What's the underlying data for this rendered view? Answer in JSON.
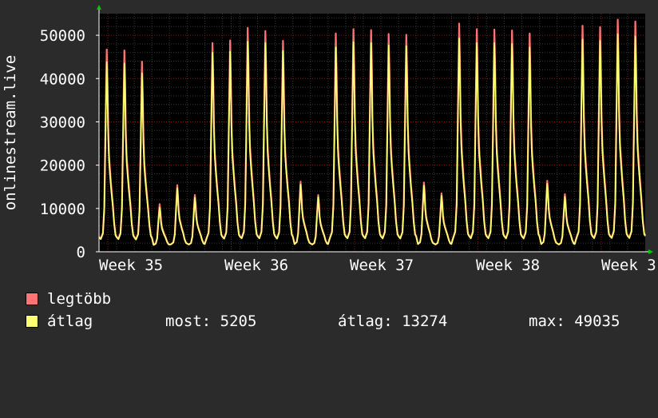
{
  "chart_data": {
    "type": "line",
    "ylabel": "onlinestream.live",
    "yticks": [
      0,
      10000,
      20000,
      30000,
      40000,
      50000
    ],
    "ylim": [
      0,
      55000
    ],
    "xticks": [
      "Week 35",
      "Week 36",
      "Week 37",
      "Week 38",
      "Week 3"
    ],
    "grid": true,
    "background": "#000000",
    "series": [
      {
        "name": "legtöbb",
        "color": "#ff7373",
        "daily_peaks": [
          45500,
          45300,
          42700,
          9800,
          14200,
          11900,
          47000,
          47600,
          50500,
          49800,
          47500,
          15000,
          11900,
          49200,
          50200,
          50000,
          49100,
          48900,
          14800,
          12300,
          51500,
          50200,
          50100,
          49900,
          49200,
          15200,
          12100,
          51000,
          50700,
          52400,
          52000
        ]
      },
      {
        "name": "átlag",
        "color": "#ffff73",
        "daily_peaks": [
          42600,
          42300,
          40000,
          9000,
          13500,
          11300,
          44800,
          45000,
          47300,
          47000,
          45200,
          14300,
          11400,
          46000,
          47200,
          47000,
          46500,
          46300,
          14100,
          11700,
          48100,
          47000,
          47000,
          46800,
          46000,
          14500,
          11500,
          47800,
          47500,
          49035,
          48500
        ]
      }
    ]
  },
  "legend": {
    "max_label": "legtöbb",
    "avg_label": "átlag",
    "max_color": "#ff7373",
    "avg_color": "#ffff73",
    "stat_now": "most: 5205",
    "stat_avg": "átlag: 13274",
    "stat_max": "max: 49035"
  }
}
